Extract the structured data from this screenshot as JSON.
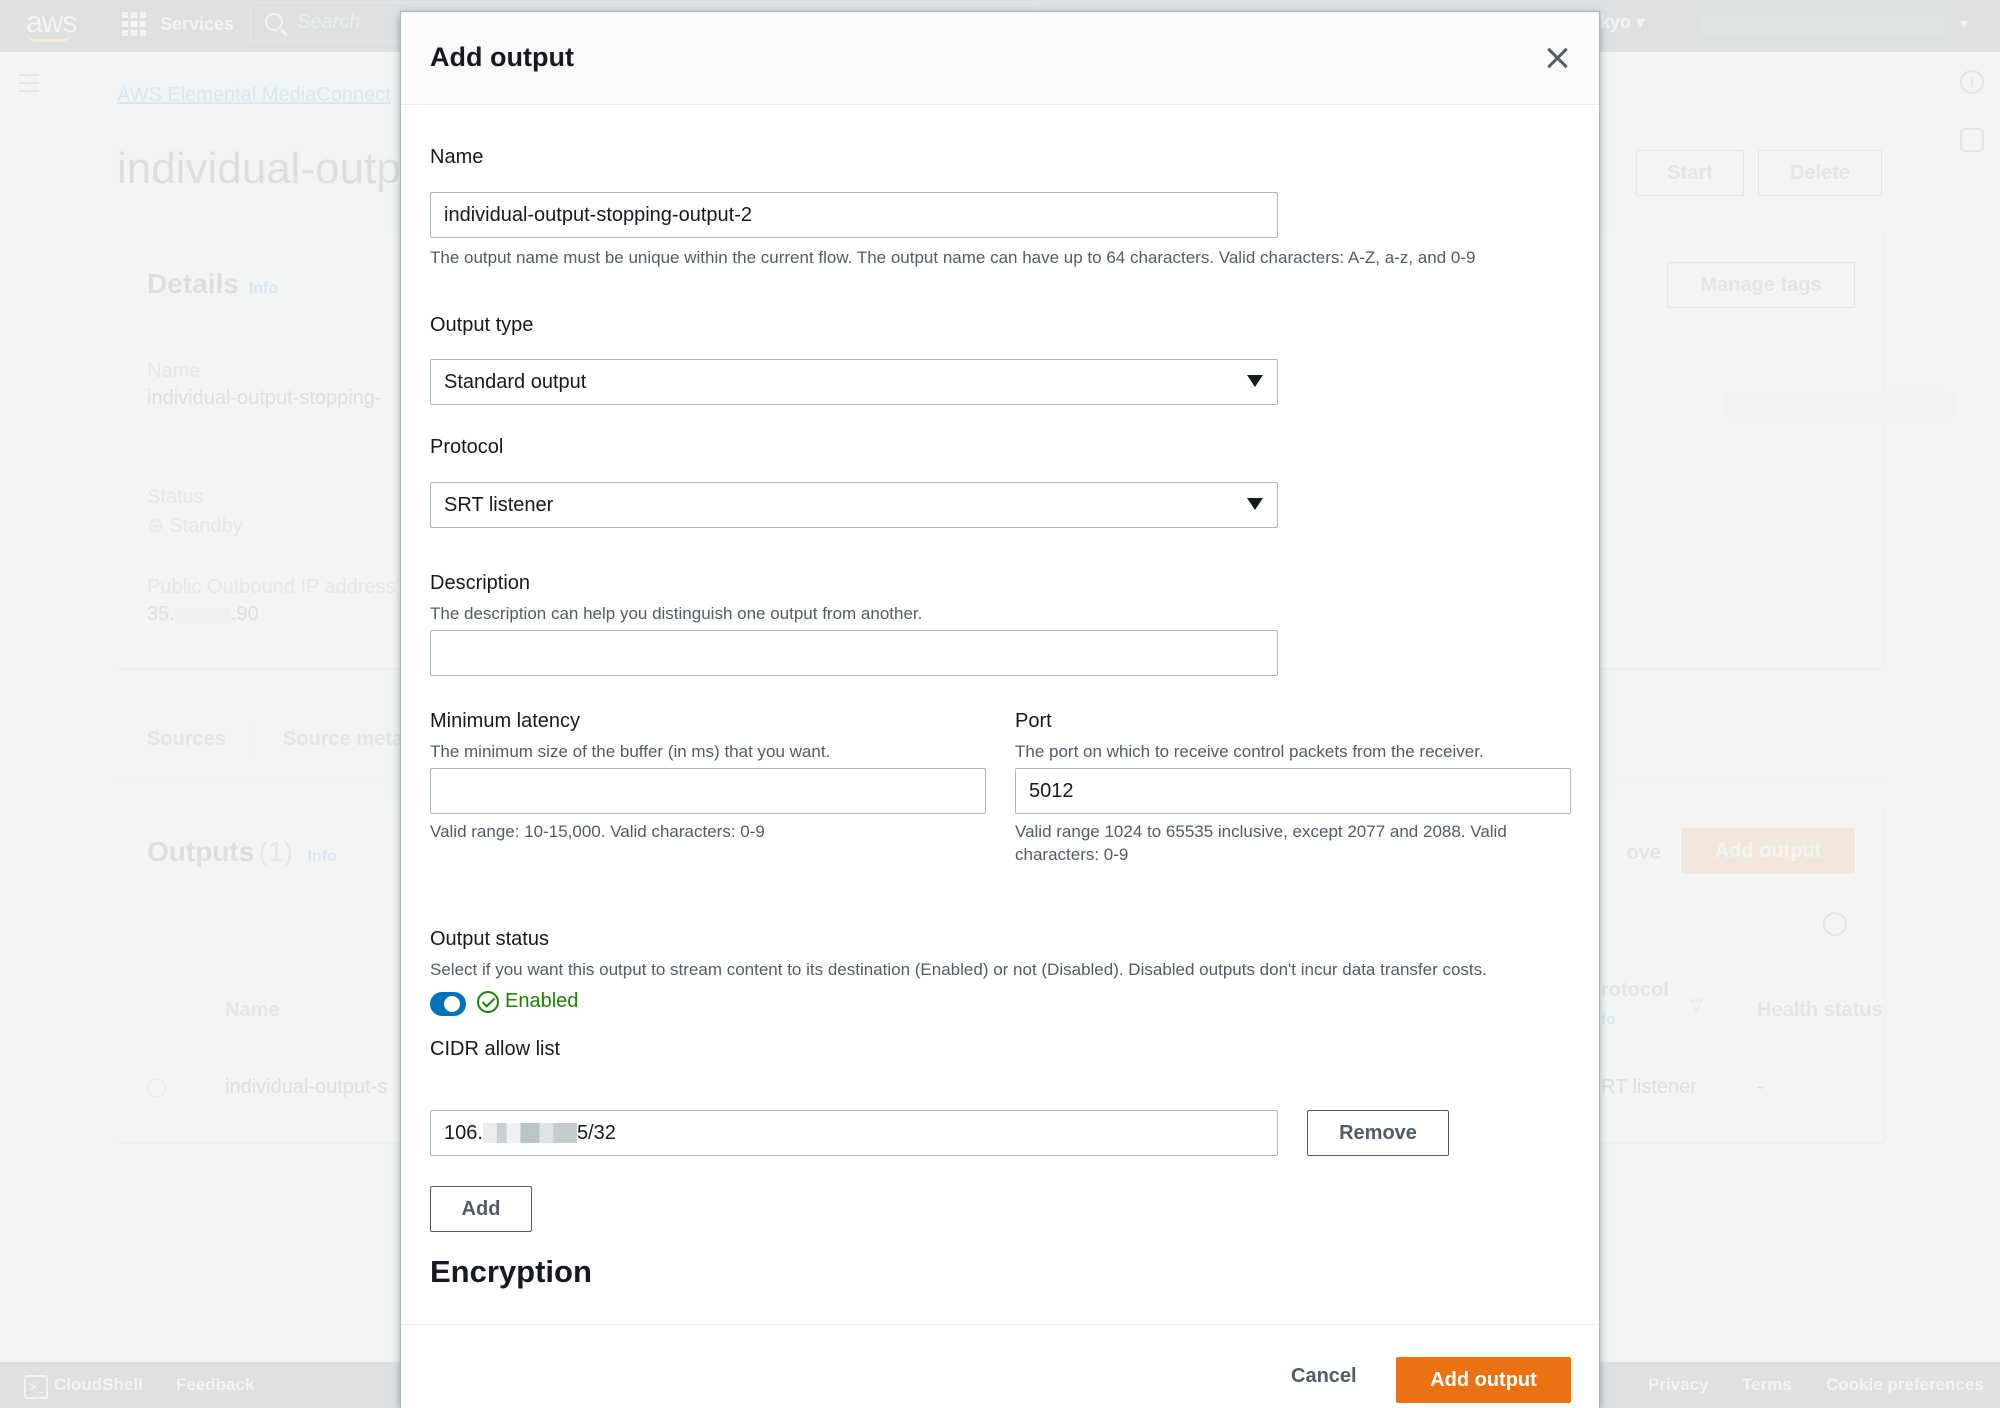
{
  "console": {
    "logo": "aws",
    "services_label": "Services",
    "search_placeholder": "Search",
    "region_label": "kyo",
    "breadcrumb": "AWS Elemental MediaConnect",
    "page_title": "individual-outp",
    "start_label": "Start",
    "delete_label": "Delete",
    "details": {
      "title": "Details",
      "info": "Info",
      "manage_tags": "Manage tags",
      "name_key": "Name",
      "name_value": "individual-output-stopping-",
      "status_key": "Status",
      "status_value": "Standby",
      "ip_key": "Public Outbound IP address",
      "ip_prefix": "35.",
      "ip_suffix": ".90"
    },
    "tabs": [
      "Sources",
      "Source meta"
    ],
    "outputs": {
      "title": "Outputs",
      "count": "(1)",
      "info": "Info",
      "remove_label": "ove",
      "add_label": "Add output",
      "columns": [
        "Name",
        "rotocol",
        "Health status"
      ],
      "protocol_info": "fo",
      "rows": [
        {
          "name": "individual-output-s",
          "protocol": "RT listener",
          "health": "-"
        }
      ]
    },
    "footer": {
      "cloudshell": "CloudShell",
      "feedback": "Feedback",
      "privacy": "Privacy",
      "terms": "Terms",
      "cookies": "Cookie preferences"
    }
  },
  "modal": {
    "title": "Add output",
    "name": {
      "label": "Name",
      "value": "individual-output-stopping-output-2",
      "hint": "The output name must be unique within the current flow. The output name can have up to 64 characters. Valid characters: A-Z, a-z, and 0-9"
    },
    "output_type": {
      "label": "Output type",
      "value": "Standard output"
    },
    "protocol": {
      "label": "Protocol",
      "value": "SRT listener"
    },
    "description": {
      "label": "Description",
      "hint": "The description can help you distinguish one output from another.",
      "value": ""
    },
    "min_latency": {
      "label": "Minimum latency",
      "hint": "The minimum size of the buffer (in ms) that you want.",
      "value": "",
      "constraint": "Valid range: 10-15,000. Valid characters: 0-9"
    },
    "port": {
      "label": "Port",
      "hint": "The port on which to receive control packets from the receiver.",
      "value": "5012",
      "constraint": "Valid range 1024 to 65535 inclusive, except 2077 and 2088. Valid characters: 0-9"
    },
    "output_status": {
      "label": "Output status",
      "hint": "Select if you want this output to stream content to its destination (Enabled) or not (Disabled). Disabled outputs don't incur data transfer costs.",
      "enabled": true,
      "state_label": "Enabled"
    },
    "cidr": {
      "label": "CIDR allow list",
      "entries": [
        {
          "prefix": "106.",
          "suffix": "5/32"
        }
      ],
      "remove_label": "Remove",
      "add_label": "Add"
    },
    "encryption_title": "Encryption",
    "cancel_label": "Cancel",
    "submit_label": "Add output"
  },
  "colors": {
    "primary": "#ec7211",
    "link": "#0073bb",
    "success": "#1d8102"
  }
}
